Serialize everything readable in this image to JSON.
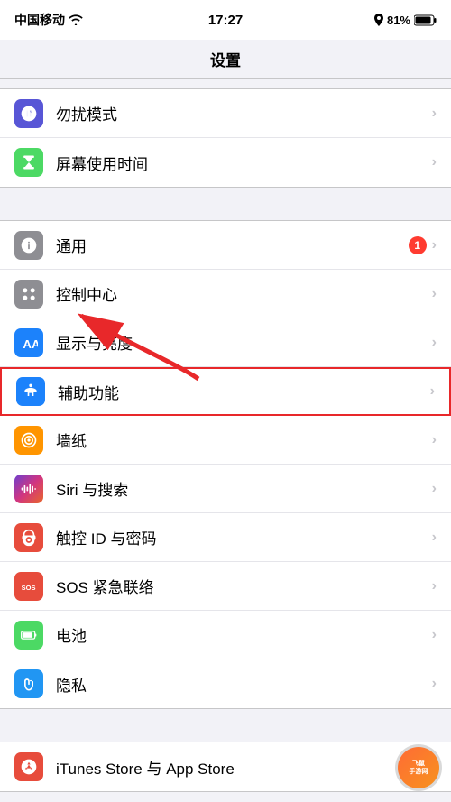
{
  "statusBar": {
    "carrier": "中国移动",
    "wifi": "wifi",
    "time": "17:27",
    "location": true,
    "battery": "81%"
  },
  "header": {
    "title": "设置"
  },
  "sections": [
    {
      "id": "section1",
      "items": [
        {
          "id": "dnd",
          "label": "勿扰模式",
          "iconColor": "#5856d6",
          "iconType": "dnd",
          "badge": null,
          "highlighted": false
        },
        {
          "id": "screentime",
          "label": "屏幕使用时间",
          "iconColor": "#4cd964",
          "iconType": "screentime",
          "badge": null,
          "highlighted": false
        }
      ]
    },
    {
      "id": "section2",
      "items": [
        {
          "id": "general",
          "label": "通用",
          "iconColor": "#8e8e93",
          "iconType": "general",
          "badge": "1",
          "highlighted": false
        },
        {
          "id": "control",
          "label": "控制中心",
          "iconColor": "#8e8e93",
          "iconType": "control",
          "badge": null,
          "highlighted": false
        },
        {
          "id": "display",
          "label": "显示与亮度",
          "iconColor": "#1c82fb",
          "iconType": "display",
          "badge": null,
          "highlighted": false
        },
        {
          "id": "access",
          "label": "辅助功能",
          "iconColor": "#1c82fb",
          "iconType": "access",
          "badge": null,
          "highlighted": true
        },
        {
          "id": "wallpaper",
          "label": "墙纸",
          "iconColor": "#ff9500",
          "iconType": "wallpaper",
          "badge": null,
          "highlighted": false
        },
        {
          "id": "siri",
          "label": "Siri 与搜索",
          "iconColor": "#1c1c1e",
          "iconType": "siri",
          "badge": null,
          "highlighted": false
        },
        {
          "id": "touchid",
          "label": "触控 ID 与密码",
          "iconColor": "#e74c3c",
          "iconType": "touchid",
          "badge": null,
          "highlighted": false
        },
        {
          "id": "sos",
          "label": "SOS 紧急联络",
          "iconColor": "#e74c3c",
          "iconType": "sos",
          "badge": null,
          "highlighted": false
        },
        {
          "id": "battery",
          "label": "电池",
          "iconColor": "#4cd964",
          "iconType": "battery",
          "badge": null,
          "highlighted": false
        },
        {
          "id": "privacy",
          "label": "隐私",
          "iconColor": "#2196f3",
          "iconType": "privacy",
          "badge": null,
          "highlighted": false
        }
      ]
    },
    {
      "id": "section3",
      "items": [
        {
          "id": "itunes",
          "label": "iTunes Store 与 App Store",
          "iconColor": "#e74c3c",
          "iconType": "itunes",
          "badge": null,
          "highlighted": false
        }
      ]
    }
  ],
  "chevron": "›",
  "arrowText": "→"
}
